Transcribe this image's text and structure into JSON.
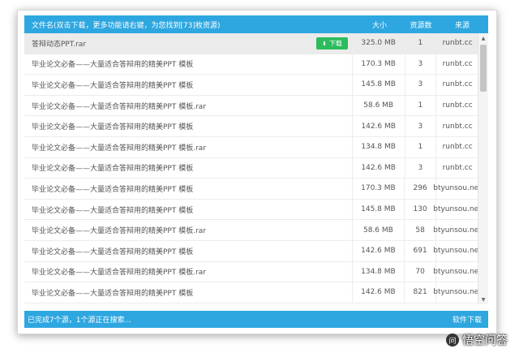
{
  "header": {
    "name": "文件名(双击下载，更多功能请右键，为您找到[73]枚资源)",
    "size": "大小",
    "count": "资源数",
    "source": "来源"
  },
  "download_label": "下载",
  "rows": [
    {
      "name": "答辩动态PPT.rar",
      "size": "325.0 MB",
      "count": "1",
      "source": "runbt.cc"
    },
    {
      "name": "毕业论文必备——大量适合答辩用的精美PPT 模板",
      "size": "170.3 MB",
      "count": "3",
      "source": "runbt.cc"
    },
    {
      "name": "毕业论文必备——大量适合答辩用的精美PPT 模板",
      "size": "145.8 MB",
      "count": "3",
      "source": "runbt.cc"
    },
    {
      "name": "毕业论文必备——大量适合答辩用的精美PPT 模板.rar",
      "size": "58.6 MB",
      "count": "1",
      "source": "runbt.cc"
    },
    {
      "name": "毕业论文必备——大量适合答辩用的精美PPT 模板",
      "size": "142.6 MB",
      "count": "3",
      "source": "runbt.cc"
    },
    {
      "name": "毕业论文必备——大量适合答辩用的精美PPT 模板.rar",
      "size": "134.8 MB",
      "count": "1",
      "source": "runbt.cc"
    },
    {
      "name": "毕业论文必备——大量适合答辩用的精美PPT 模板",
      "size": "142.6 MB",
      "count": "3",
      "source": "runbt.cc"
    },
    {
      "name": "毕业论文必备——大量适合答辩用的精美PPT 模板",
      "size": "170.3 MB",
      "count": "296",
      "source": "btyunsou.net"
    },
    {
      "name": "毕业论文必备——大量适合答辩用的精美PPT 模板",
      "size": "145.8 MB",
      "count": "130",
      "source": "btyunsou.net"
    },
    {
      "name": "毕业论文必备——大量适合答辩用的精美PPT 模板.rar",
      "size": "58.6 MB",
      "count": "58",
      "source": "btyunsou.net"
    },
    {
      "name": "毕业论文必备——大量适合答辩用的精美PPT 模板",
      "size": "142.6 MB",
      "count": "691",
      "source": "btyunsou.net"
    },
    {
      "name": "毕业论文必备——大量适合答辩用的精美PPT 模板.rar",
      "size": "134.8 MB",
      "count": "70",
      "source": "btyunsou.net"
    },
    {
      "name": "毕业论文必备——大量适合答辩用的精美PPT 模板",
      "size": "142.6 MB",
      "count": "821",
      "source": "btyunsou.net"
    }
  ],
  "footer": {
    "status": "已完成7个源，1个源正在搜索...",
    "right": "软件下载"
  },
  "watermark": "悟空问答",
  "colors": {
    "accent": "#2ea7e0",
    "download_button": "#2dbb5d",
    "selected_row": "#ebebeb"
  },
  "icons": {
    "download": "download-arrow-icon",
    "scroll_up": "scroll-up-icon",
    "scroll_down": "scroll-down-icon"
  }
}
